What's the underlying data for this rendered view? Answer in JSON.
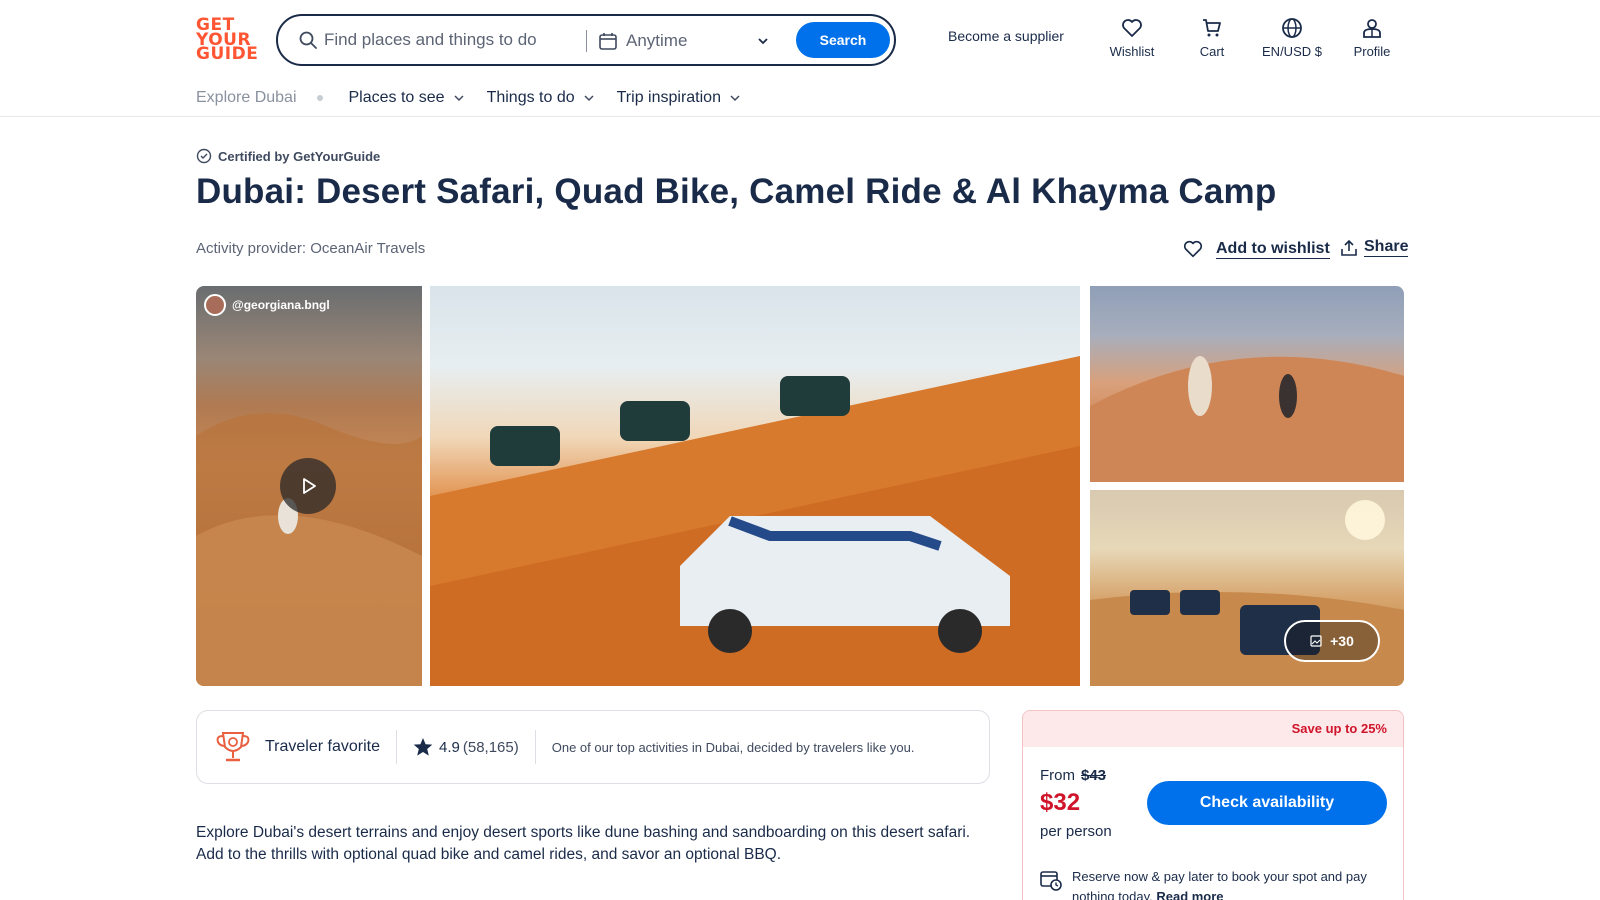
{
  "header": {
    "logo": [
      "GET",
      "YOUR",
      "GUIDE"
    ],
    "search": {
      "placeholder": "Find places and things to do",
      "date_label": "Anytime",
      "button": "Search"
    },
    "supplier": "Become a supplier",
    "nav": [
      {
        "label": "Wishlist",
        "icon": "heart-icon"
      },
      {
        "label": "Cart",
        "icon": "cart-icon"
      },
      {
        "label": "EN/USD $",
        "icon": "globe-icon"
      },
      {
        "label": "Profile",
        "icon": "profile-icon"
      }
    ]
  },
  "subnav": {
    "explore": "Explore Dubai",
    "menus": [
      "Places to see",
      "Things to do",
      "Trip inspiration"
    ]
  },
  "activity": {
    "certified": "Certified by GetYourGuide",
    "title": "Dubai: Desert Safari, Quad Bike, Camel Ride & Al Khayma Camp",
    "provider_prefix": "Activity provider: ",
    "provider_name": "OceanAir Travels",
    "wishlist_label": "Add to wishlist",
    "share_label": "Share"
  },
  "gallery": {
    "video_user": "@georgiana.bngl",
    "more_photos": "+30"
  },
  "badge": {
    "label": "Traveler favorite",
    "rating": "4.9",
    "review_count": "(58,165)",
    "message": "One of our top activities in Dubai, decided by travelers like you."
  },
  "description": "Explore Dubai's desert terrains and enjoy desert sports like dune bashing and sandboarding on this desert safari. Add to the thrills with optional quad bike and camel rides, and savor an optional BBQ.",
  "booking": {
    "save": "Save up to 25%",
    "from": "From",
    "old_price": "$43",
    "price": "$32",
    "per_person": "per person",
    "button": "Check availability",
    "reserve_text": "Reserve now & pay later to book your spot and pay nothing today.",
    "read_more": "Read more"
  },
  "colors": {
    "brand": "#ff5533",
    "primary_button": "#0071eb",
    "sale_red": "#d0142a",
    "text_dark": "#1a2b49"
  }
}
